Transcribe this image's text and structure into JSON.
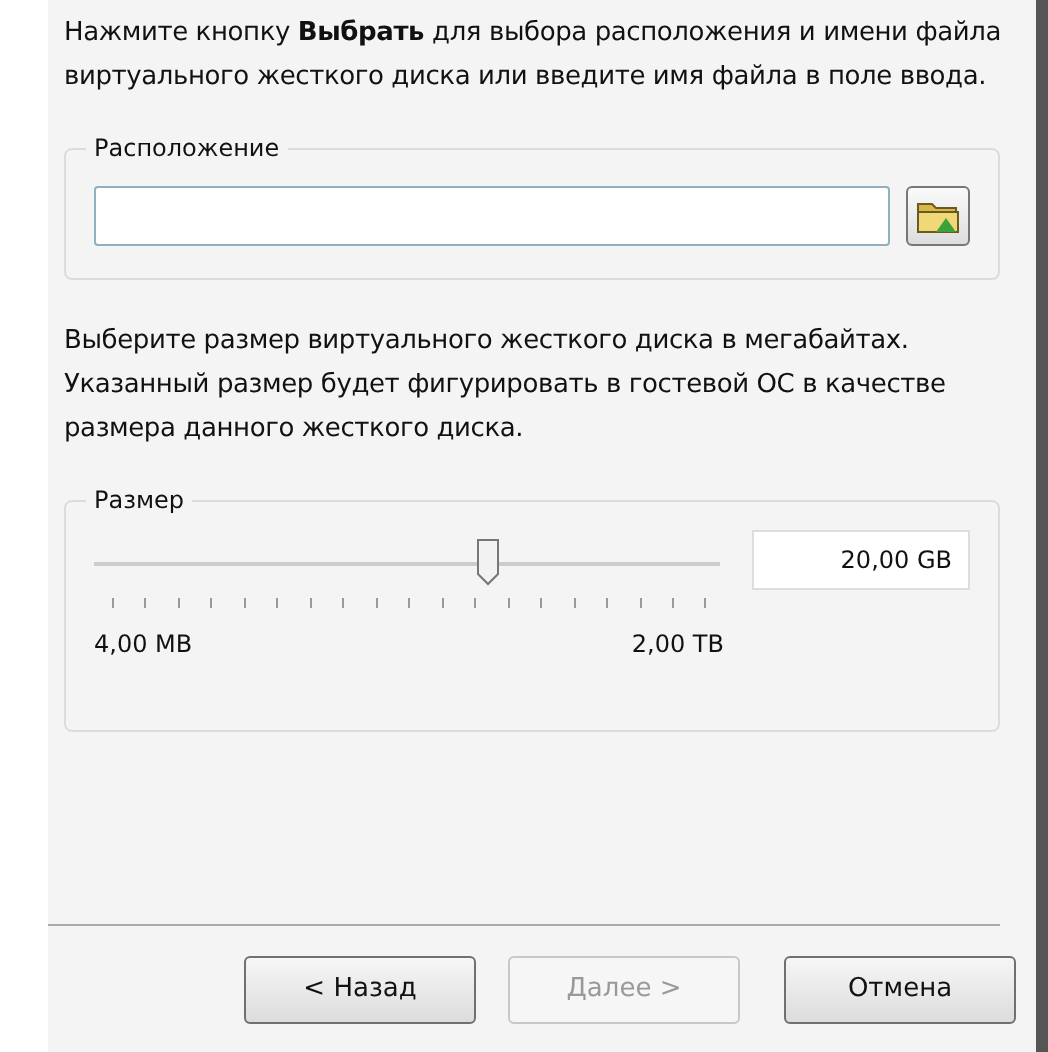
{
  "intro": "Нажмите кнопку **Выбрать** для выбора расположения и имени файла виртуального жесткого диска или введите имя файла в поле ввода.",
  "location": {
    "legend": "Расположение"
  },
  "size_text": "Выберите размер виртуального жесткого диска в мегабайтах. Указанный размер будет фигурировать в гостевой ОС в качестве размера данного жесткого диска.",
  "size": {
    "legend": "Размер",
    "level": 0.63,
    "value": "20,00 GB",
    "min_label": "4,00 MB",
    "max_label": "2,00 TB"
  },
  "buttons": [
    {
      "label": "< Назад",
      "disabled": false
    },
    {
      "label": "Далее >",
      "disabled": true
    },
    {
      "label": "Отмена",
      "disabled": false
    }
  ]
}
